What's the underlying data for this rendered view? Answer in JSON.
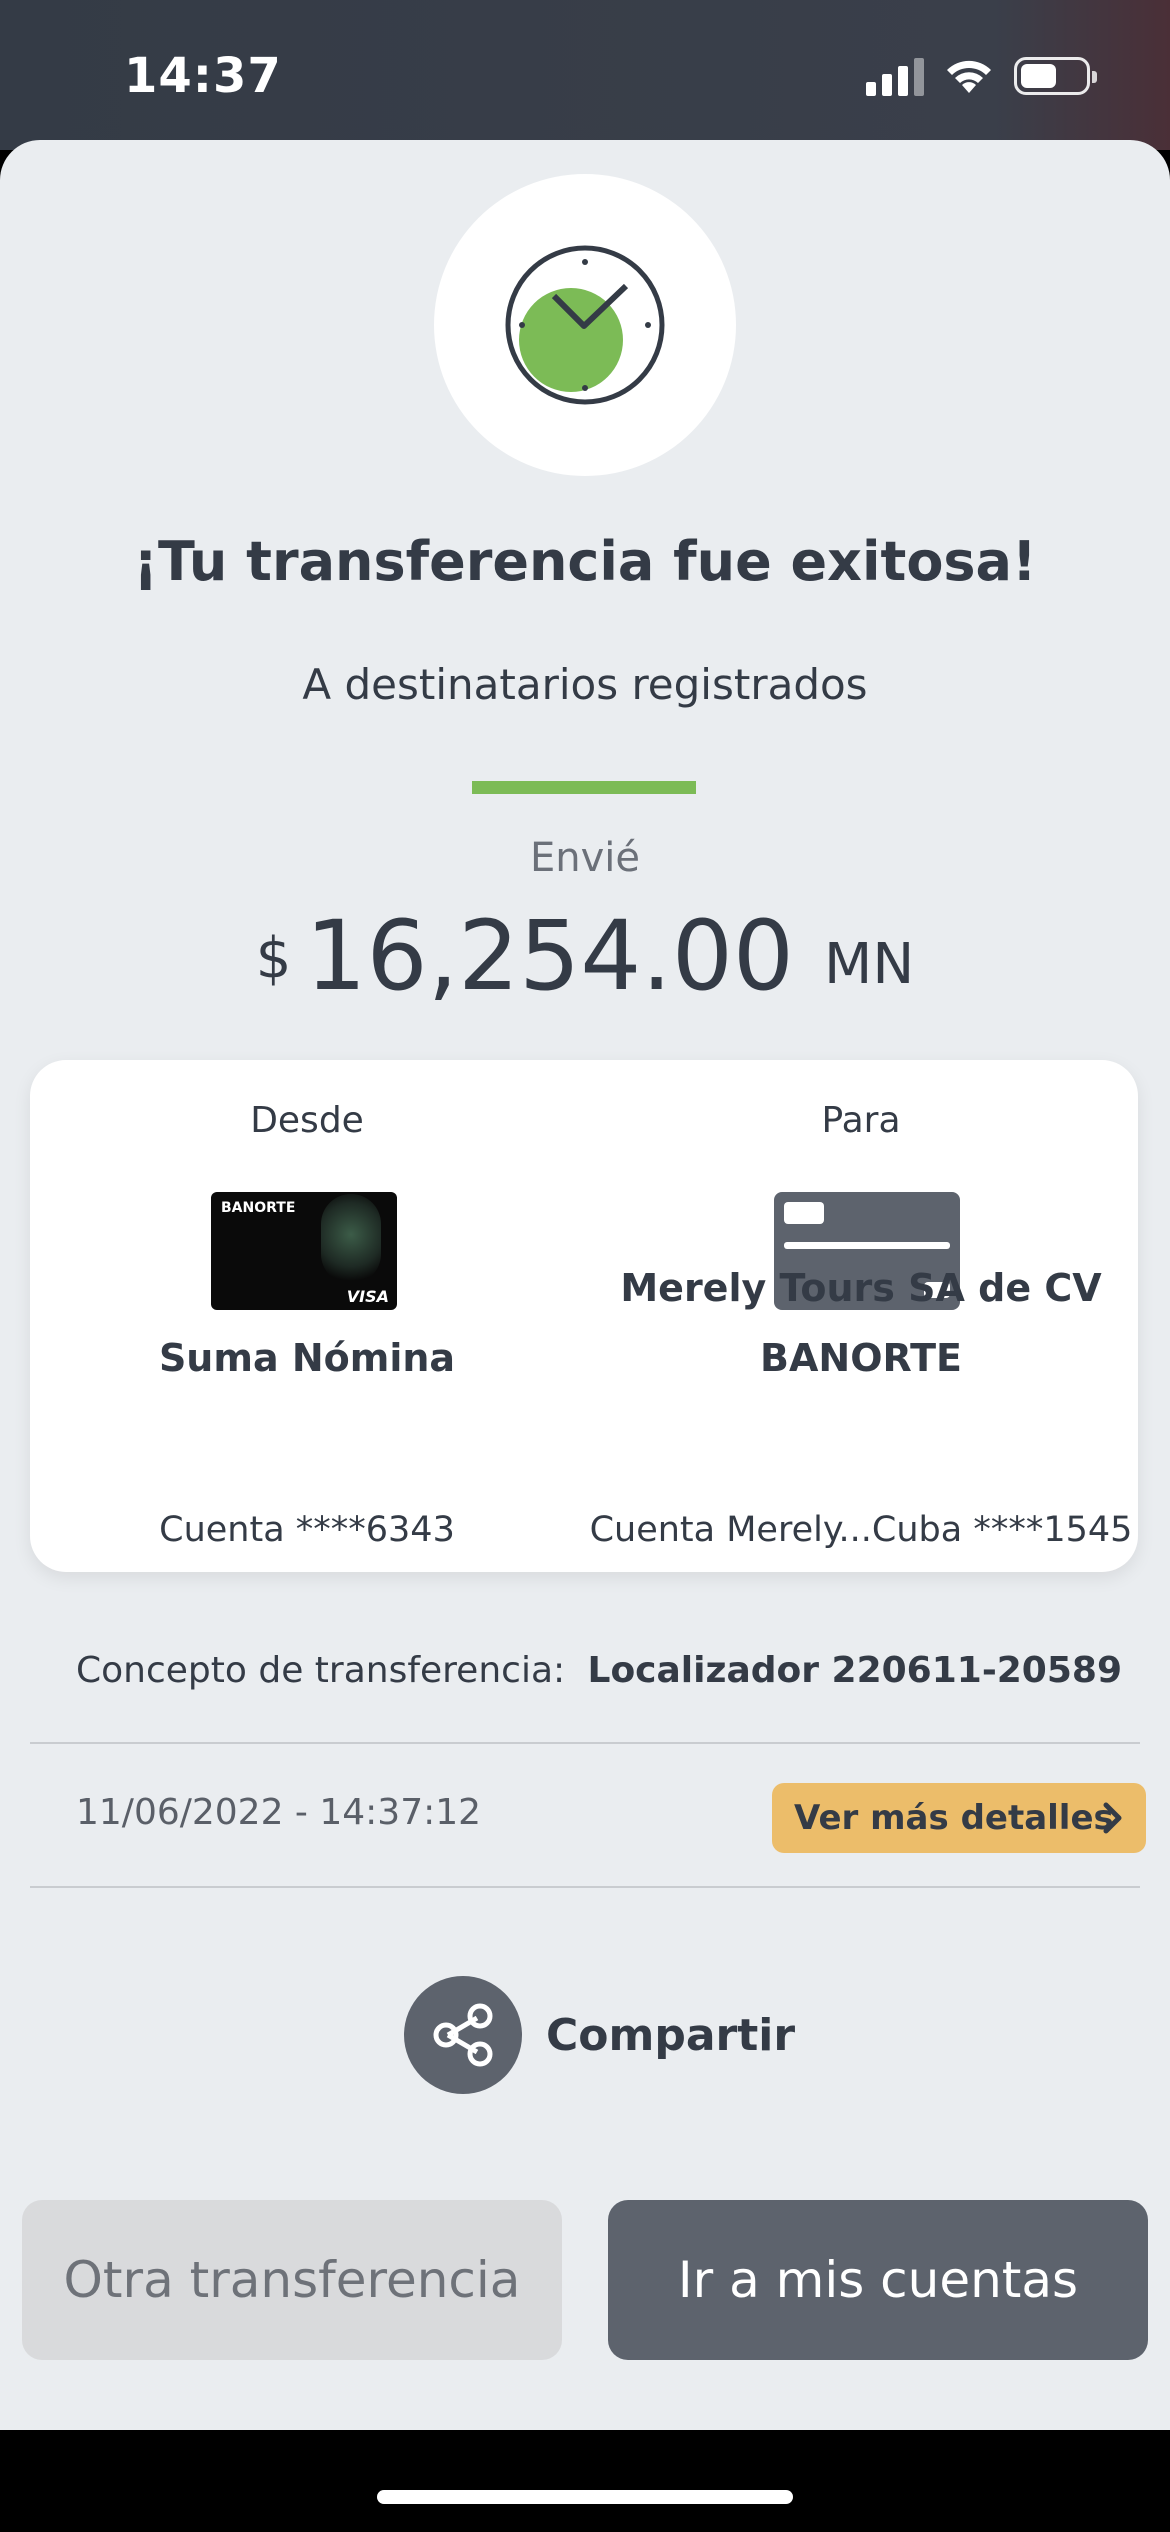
{
  "status_bar": {
    "time": "14:37"
  },
  "header": {
    "title": "¡Tu transferencia fue exitosa!",
    "subtitle": "A destinatarios registrados"
  },
  "amount": {
    "label": "Envié",
    "currency_symbol": "$",
    "value": "16,254.00",
    "suffix": "MN"
  },
  "transfer": {
    "from": {
      "label": "Desde",
      "card_brand": "BANORTE",
      "card_network": "VISA",
      "name": "Suma Nómina",
      "account": "Cuenta ****6343"
    },
    "to": {
      "label": "Para",
      "name": "Merely Tours SA de CV",
      "bank": "BANORTE",
      "account": "Cuenta Merely...Cuba ****1545"
    }
  },
  "details": {
    "concept_label": "Concepto de transferencia:",
    "concept_value": "Localizador 220611-20589",
    "datetime": "11/06/2022 - 14:37:12",
    "more_details_label": "Ver más detalles"
  },
  "share": {
    "label": "Compartir"
  },
  "actions": {
    "secondary_label": "Otra transferencia",
    "primary_label": "Ir a mis cuentas"
  },
  "colors": {
    "accent_green": "#7cbb56",
    "details_button": "#ecbd6a",
    "dark_text": "#343b46",
    "primary_button": "#5d636d",
    "background": "#eaedf0"
  }
}
